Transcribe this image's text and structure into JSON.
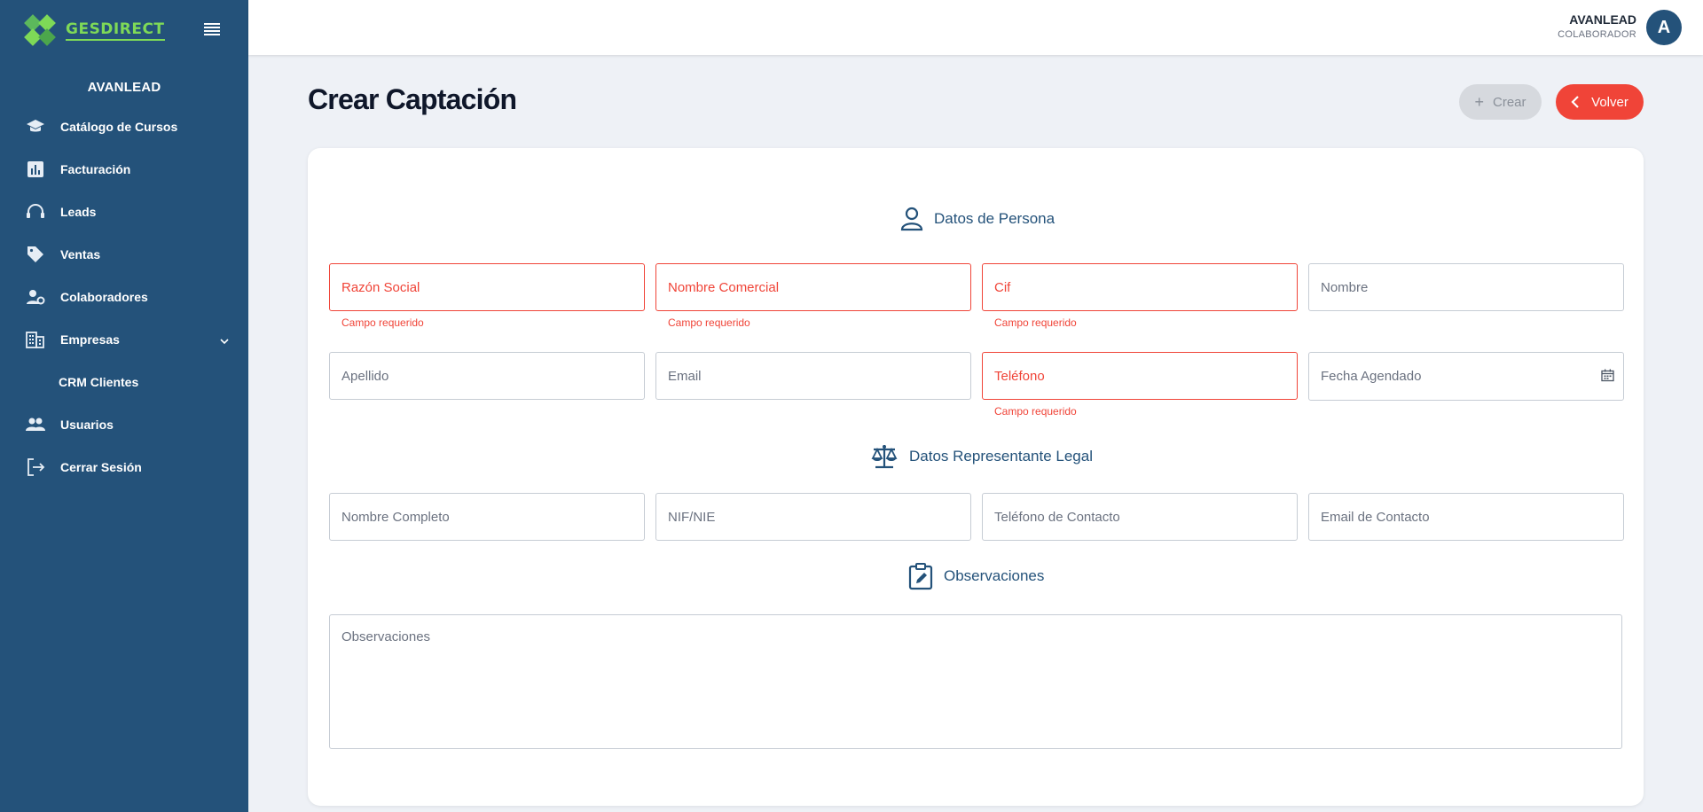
{
  "brand": {
    "name": "GESDIRECT"
  },
  "sidebar": {
    "company": "AVANLEAD",
    "items": [
      {
        "label": "Catálogo de Cursos",
        "icon": "graduation-cap-icon"
      },
      {
        "label": "Facturación",
        "icon": "bar-chart-icon"
      },
      {
        "label": "Leads",
        "icon": "headset-icon"
      },
      {
        "label": "Ventas",
        "icon": "tag-icon"
      },
      {
        "label": "Colaboradores",
        "icon": "user-gear-icon"
      },
      {
        "label": "Empresas",
        "icon": "building-icon"
      },
      {
        "label": "CRM Clientes",
        "icon": ""
      },
      {
        "label": "Usuarios",
        "icon": "users-icon"
      },
      {
        "label": "Cerrar Sesión",
        "icon": "logout-icon"
      }
    ]
  },
  "header": {
    "user_name": "AVANLEAD",
    "user_role": "COLABORADOR",
    "avatar_letter": "A"
  },
  "page": {
    "title": "Crear Captación",
    "create_label": "Crear",
    "back_label": "Volver"
  },
  "form": {
    "persona_title": "Datos de Persona",
    "representante_title": "Datos Representante Legal",
    "observaciones_title": "Observaciones",
    "required_msg": "Campo requerido",
    "fields": {
      "razon_social": "Razón Social",
      "nombre_comercial": "Nombre Comercial",
      "cif": "Cif",
      "nombre": "Nombre",
      "apellido": "Apellido",
      "email": "Email",
      "telefono": "Teléfono",
      "fecha_agendado": "Fecha Agendado",
      "nombre_completo": "Nombre Completo",
      "nif_nie": "NIF/NIE",
      "telefono_contacto": "Teléfono de Contacto",
      "email_contacto": "Email de Contacto",
      "observaciones": "Observaciones"
    }
  },
  "colors": {
    "sidebar": "#24527a",
    "brand_green": "#7ed957",
    "error": "#f04438",
    "accent": "#24527a"
  }
}
